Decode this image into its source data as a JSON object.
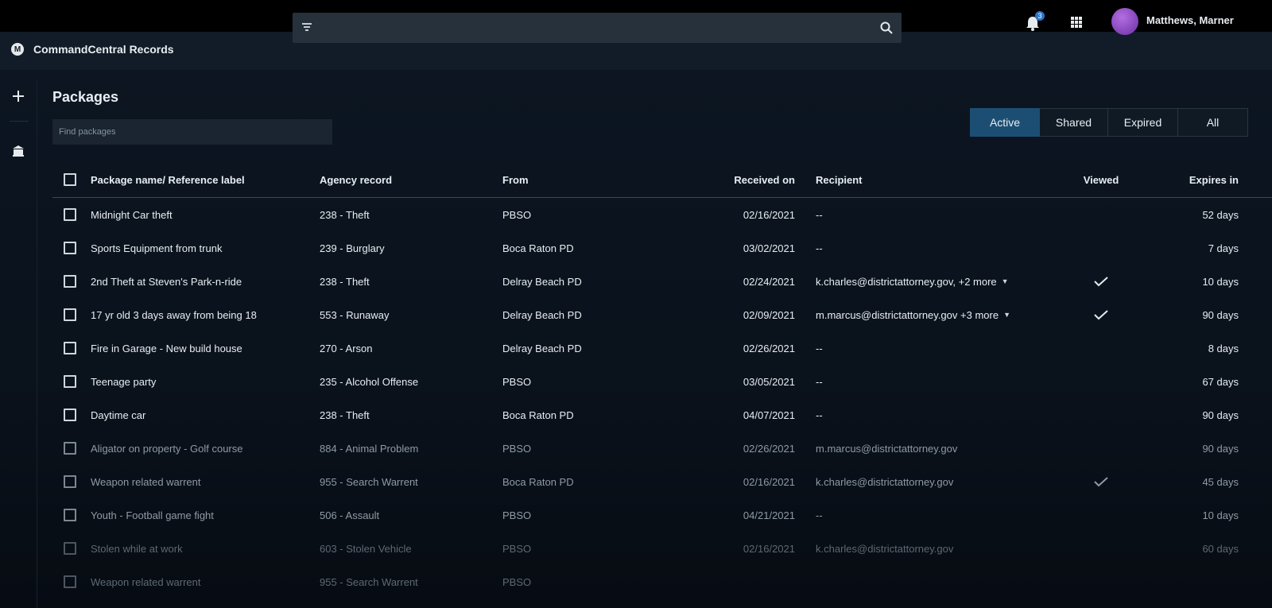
{
  "app": {
    "title": "CommandCentral Records",
    "logo_letter": "M",
    "username": "Matthews, Marner",
    "notification_count": "3"
  },
  "search": {
    "placeholder": ""
  },
  "page": {
    "title": "Packages",
    "find_placeholder": "Find packages"
  },
  "tabs": [
    {
      "label": "Active",
      "active": true
    },
    {
      "label": "Shared",
      "active": false
    },
    {
      "label": "Expired",
      "active": false
    },
    {
      "label": "All",
      "active": false
    }
  ],
  "table": {
    "headers": {
      "name": "Package name/ Reference label",
      "agency": "Agency record",
      "from": "From",
      "received": "Received on",
      "recipient": "Recipient",
      "viewed": "Viewed",
      "expires": "Expires in"
    },
    "rows": [
      {
        "name": "Midnight Car theft",
        "agency": "238 - Theft",
        "from": "PBSO",
        "received": "02/16/2021",
        "recipient": "--",
        "viewed": false,
        "expires": "52 days"
      },
      {
        "name": "Sports Equipment from trunk",
        "agency": "239 - Burglary",
        "from": "Boca Raton PD",
        "received": "03/02/2021",
        "recipient": "--",
        "viewed": false,
        "expires": "7 days"
      },
      {
        "name": "2nd Theft at Steven's Park-n-ride",
        "agency": "238 - Theft",
        "from": "Delray Beach PD",
        "received": "02/24/2021",
        "recipient": "k.charles@districtattorney.gov, +2 more",
        "viewed": true,
        "expires": "10 days"
      },
      {
        "name": "17 yr old 3 days away from being 18",
        "agency": "553 - Runaway",
        "from": "Delray Beach PD",
        "received": "02/09/2021",
        "recipient": "m.marcus@districtattorney.gov +3 more",
        "viewed": true,
        "expires": "90 days"
      },
      {
        "name": "Fire in Garage - New build house",
        "agency": "270 - Arson",
        "from": "Delray Beach PD",
        "received": "02/26/2021",
        "recipient": "--",
        "viewed": false,
        "expires": "8 days"
      },
      {
        "name": "Teenage party",
        "agency": "235 - Alcohol Offense",
        "from": "PBSO",
        "received": "03/05/2021",
        "recipient": "--",
        "viewed": false,
        "expires": "67 days"
      },
      {
        "name": "Daytime car",
        "agency": "238 - Theft",
        "from": "Boca Raton PD",
        "received": "04/07/2021",
        "recipient": "--",
        "viewed": false,
        "expires": "90 days"
      },
      {
        "name": "Aligator on property - Golf course",
        "agency": "884 - Animal Problem",
        "from": "PBSO",
        "received": "02/26/2021",
        "recipient": "m.marcus@districtattorney.gov",
        "viewed": false,
        "expires": "90 days"
      },
      {
        "name": "Weapon related warrent",
        "agency": "955 - Search Warrent",
        "from": "Boca Raton PD",
        "received": "02/16/2021",
        "recipient": "k.charles@districtattorney.gov",
        "viewed": true,
        "expires": "45 days"
      },
      {
        "name": "Youth - Football game fight",
        "agency": "506 - Assault",
        "from": "PBSO",
        "received": "04/21/2021",
        "recipient": "--",
        "viewed": false,
        "expires": "10 days"
      },
      {
        "name": "Stolen while at work",
        "agency": "603 - Stolen Vehicle",
        "from": "PBSO",
        "received": "02/16/2021",
        "recipient": "k.charles@districtattorney.gov",
        "viewed": false,
        "expires": "60 days"
      },
      {
        "name": "Weapon related warrent",
        "agency": "955 - Search Warrent",
        "from": "PBSO",
        "received": "",
        "recipient": "",
        "viewed": false,
        "expires": ""
      }
    ]
  }
}
